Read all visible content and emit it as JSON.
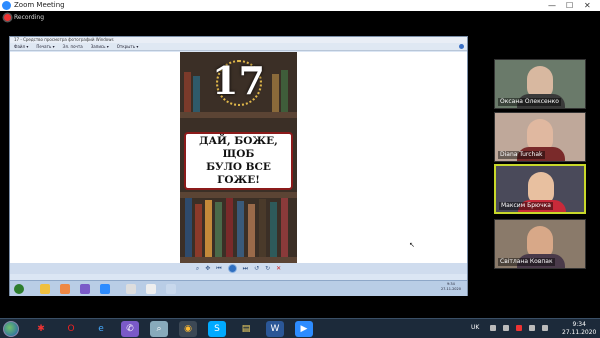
{
  "zoom": {
    "window_title": "Zoom Meeting",
    "recording_label": "Recording",
    "window_buttons": [
      "—",
      "☐",
      "✕"
    ]
  },
  "viewer": {
    "title": "17 - Средство просмотра фотографий Windows",
    "menu": [
      "Файл ▾",
      "Печать ▾",
      "Эл. почта",
      "Запись ▾",
      "Открыть ▾"
    ],
    "controls": [
      "⌕",
      "✥",
      "⏮",
      "",
      "⏭",
      "↺",
      "↻",
      "✕"
    ],
    "poster_number": "17",
    "poster_text": "ДАЙ, БОЖЕ, ЩОБ\nБУЛО ВСЕ ГОЖЕ!",
    "inner_clock_time": "9:34",
    "inner_clock_date": "27.11.2020"
  },
  "participants": [
    {
      "name": "Оксана Олексенко",
      "active": false
    },
    {
      "name": "Diana Turchak",
      "active": false
    },
    {
      "name": "Максим Брючка",
      "active": true
    },
    {
      "name": "Світлана Ковпак",
      "active": false
    }
  ],
  "taskbar": {
    "apps": [
      "Adobe",
      "Opera",
      "Internet Explorer",
      "Viber",
      "Zoom Search",
      "Chrome",
      "Skype",
      "Explorer",
      "Word",
      "Zoom"
    ],
    "lang": "UK",
    "time": "9:34",
    "date": "27.11.2020"
  },
  "colors": {
    "active_speaker_border": "#c8d82a",
    "recording_dot": "#e33333",
    "poster_card_border": "#8b1a1a"
  }
}
